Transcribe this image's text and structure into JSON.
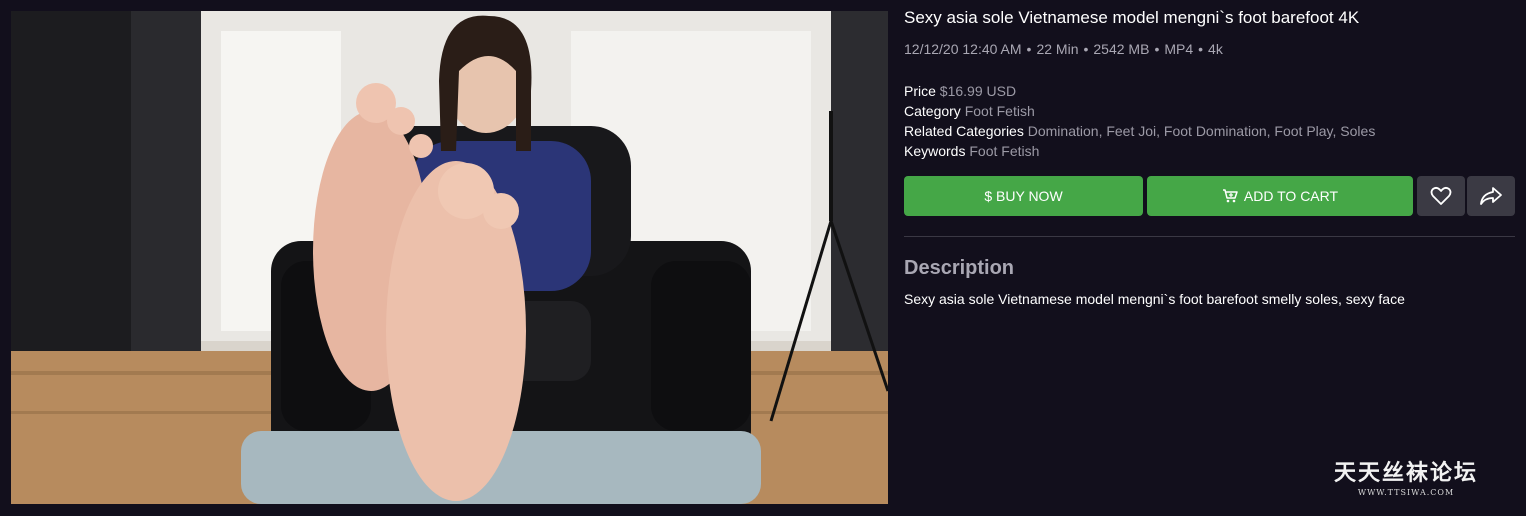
{
  "product": {
    "title": "Sexy asia sole Vietnamese model mengni`s foot barefoot 4K",
    "meta": {
      "date": "12/12/20 12:40 AM",
      "duration": "22 Min",
      "size": "2542 MB",
      "format": "MP4",
      "quality": "4k",
      "separator": "•"
    },
    "details": {
      "price_label": "Price",
      "price_value": "$16.99 USD",
      "category_label": "Category",
      "category_value": "Foot Fetish",
      "related_label": "Related Categories",
      "related_value": "Domination, Feet Joi, Foot Domination, Foot Play, Soles",
      "keywords_label": "Keywords",
      "keywords_value": "Foot Fetish"
    },
    "buttons": {
      "buy_now": "$ BUY NOW",
      "add_to_cart": "ADD TO CART",
      "favorite_icon": "heart-icon",
      "share_icon": "share-icon"
    },
    "description": {
      "heading": "Description",
      "text": "Sexy asia sole Vietnamese model mengni`s foot barefoot smelly soles, sexy face"
    }
  },
  "watermark": {
    "chinese": "天天丝袜论坛",
    "url": "WWW.TTSIWA.COM"
  },
  "colors": {
    "background": "#120f1c",
    "accent_green": "#45a747",
    "icon_button": "#3b3a44",
    "muted_text": "#a9a7b3"
  }
}
